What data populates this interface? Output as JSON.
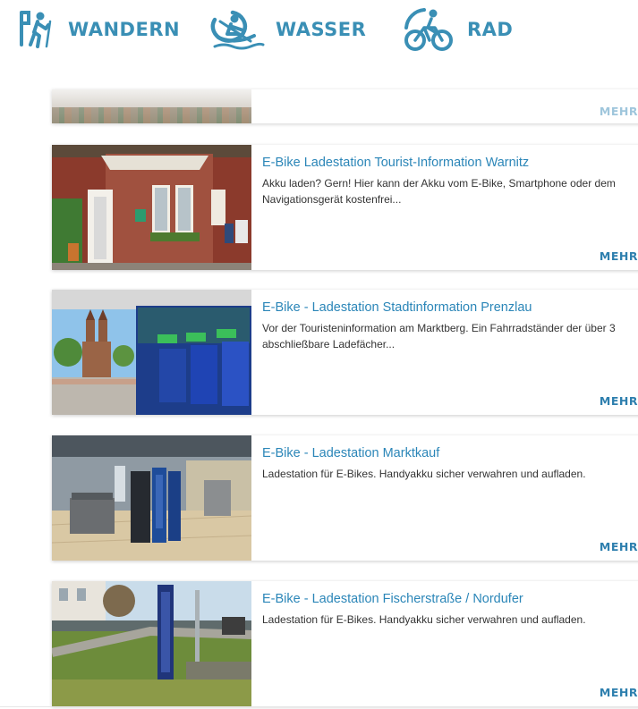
{
  "nav": {
    "items": [
      {
        "label": "WANDERN",
        "icon": "hiker-icon"
      },
      {
        "label": "WASSER",
        "icon": "canoe-icon"
      },
      {
        "label": "RAD",
        "icon": "bicycle-icon"
      }
    ],
    "color": "#3a8fb5"
  },
  "colors": {
    "title": "#2b86b8",
    "mehr": "#2e7fae",
    "text": "#333333"
  },
  "cards": [
    {
      "title": "",
      "desc": "",
      "more": "MEHR"
    },
    {
      "title": "E-Bike Ladestation Tourist-Information Warnitz",
      "desc": "Akku laden? Gern! Hier kann der Akku vom E-Bike, Smartphone oder dem Navigationsgerät kostenfrei...",
      "more": "MEHR"
    },
    {
      "title": "E-Bike - Ladestation Stadtinformation Prenzlau",
      "desc": "Vor der Touristeninformation am Marktberg. Ein Fahrradständer der über 3 abschließbare Ladefächer...",
      "more": "MEHR"
    },
    {
      "title": "E-Bike - Ladestation Marktkauf",
      "desc": "Ladestation für E-Bikes. Handyakku sicher verwahren und aufladen.",
      "more": "MEHR"
    },
    {
      "title": "E-Bike - Ladestation Fischerstraße / Nordufer",
      "desc": "Ladestation für E-Bikes. Handyakku sicher verwahren und aufladen.",
      "more": "MEHR"
    }
  ]
}
